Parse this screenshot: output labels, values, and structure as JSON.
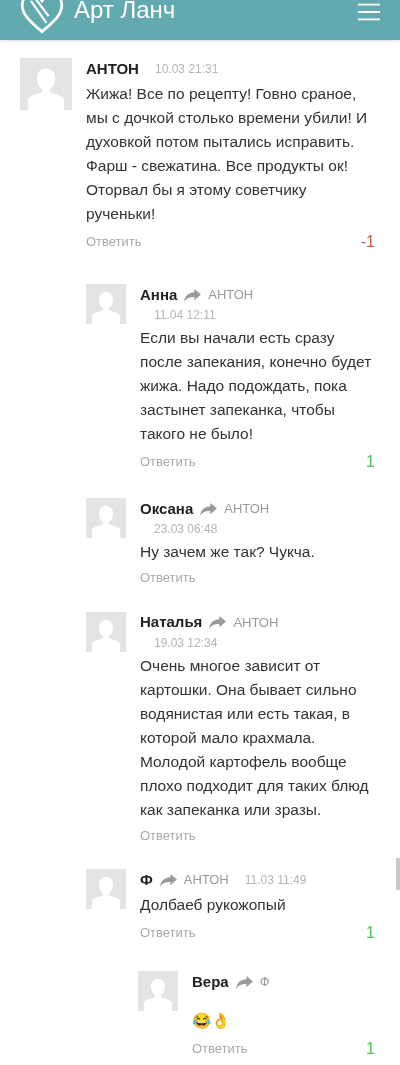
{
  "header": {
    "title": "Арт Ланч"
  },
  "comments": [
    {
      "author": "АНТОН",
      "date": "10.03 21:31",
      "kind": "inline-date",
      "text": "Жижа! Все по рецепту! Говно сраное, мы с дочкой столько времени убили! И духовкой потом пытались исправить. Фарш - свежатина. Все продукты ок! Оторвал бы я этому советчику рученьки!",
      "reply": "Ответить",
      "rating": {
        "text": "-1",
        "color": "#d9534f"
      },
      "children": [
        {
          "author": "Анна",
          "reply_to": "АНТОН",
          "date": "11.04 12:11",
          "kind": "stacked-date",
          "text": "Если вы начали есть сразу после запекания, конечно будет жижа. Надо подождать, пока застынет запеканка, чтобы такого не было!",
          "reply": "Ответить",
          "rating": {
            "text": "1",
            "color": "#4cc45a"
          }
        },
        {
          "author": "Оксана",
          "reply_to": "АНТОН",
          "date": "23.03 06:48",
          "kind": "stacked-date",
          "text": "Ну зачем же так? Чукча.",
          "reply": "Ответить"
        },
        {
          "author": "Наталья",
          "reply_to": "АНТОН",
          "date": "19.03 12:34",
          "kind": "stacked-date",
          "text": "Очень многое зависит от картошки. Она бывает сильно водянистая или есть такая, в которой мало крахмала. Молодой картофель вообще плохо подходит для таких блюд как запеканка или зразы.",
          "reply": "Ответить"
        },
        {
          "author": "Ф",
          "reply_to": "АНТОН",
          "date": "11.03 11:49",
          "kind": "inline-date",
          "text": "Долбаеб рукожопый",
          "reply": "Ответить",
          "rating": {
            "text": "1",
            "color": "#4cc45a"
          },
          "children": [
            {
              "author": "Вера",
              "reply_to": "Ф",
              "text": "😂👌",
              "reply": "Ответить",
              "rating": {
                "text": "1",
                "color": "#4cc45a"
              }
            }
          ]
        }
      ]
    }
  ]
}
